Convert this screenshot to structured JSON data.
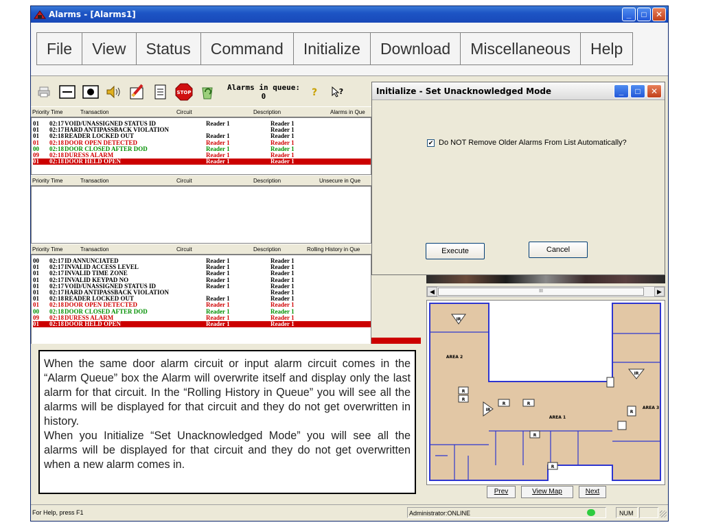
{
  "window": {
    "title": "Alarms - [Alarms1]"
  },
  "menu": [
    "File",
    "View",
    "Status",
    "Command",
    "Initialize",
    "Download",
    "Miscellaneous",
    "Help"
  ],
  "toolbar": {
    "queue_label": "Alarms in queue:",
    "queue_count": "0",
    "icons": [
      "print-icon",
      "window-icon",
      "record-icon",
      "speaker-icon",
      "acknowledge-icon",
      "notepad-icon",
      "stop-icon",
      "recycle-icon",
      "help-icon",
      "context-help-icon"
    ]
  },
  "alarm_queue": {
    "headers": [
      "Priority",
      "Time",
      "Transaction",
      "Circuit",
      "Description",
      "Alarms in Que"
    ],
    "rows": [
      {
        "p": "01",
        "t": "02:17",
        "tx": "VOID/UNASSIGNED STATUS ID",
        "c": "Reader 1",
        "d": "Reader 1",
        "style": "black"
      },
      {
        "p": "01",
        "t": "02:17",
        "tx": "HARD ANTIPASSBACK VIOLATION",
        "c": "",
        "d": "Reader 1",
        "style": "black"
      },
      {
        "p": "01",
        "t": "02:18",
        "tx": "READER LOCKED OUT",
        "c": "Reader 1",
        "d": "Reader 1",
        "style": "black"
      },
      {
        "p": "01",
        "t": "02:18",
        "tx": "DOOR OPEN DETECTED",
        "c": "Reader 1",
        "d": "Reader 1",
        "style": "red"
      },
      {
        "p": "00",
        "t": "02:18",
        "tx": "DOOR CLOSED AFTER DOD",
        "c": "Reader 1",
        "d": "Reader 1",
        "style": "green"
      },
      {
        "p": "09",
        "t": "02:18",
        "tx": "DURESS ALARM",
        "c": "Reader 1",
        "d": "Reader 1",
        "style": "red"
      },
      {
        "p": "01",
        "t": "02:18",
        "tx": "DOOR HELD OPEN",
        "c": "Reader 1",
        "d": "Reader 1",
        "style": "hl"
      }
    ]
  },
  "unsecure_queue": {
    "headers": [
      "Priority",
      "Time",
      "Transaction",
      "Circuit",
      "Description",
      "Unsecure in Que"
    ]
  },
  "history_queue": {
    "headers": [
      "Priority",
      "Time",
      "Transaction",
      "Circuit",
      "Description",
      "Rolling History in Que"
    ],
    "rows": [
      {
        "p": "00",
        "t": "02:17",
        "tx": "ID ANNUNCIATED",
        "c": "Reader 1",
        "d": "Reader 1",
        "style": "black"
      },
      {
        "p": "01",
        "t": "02:17",
        "tx": "INVALID ACCESS LEVEL",
        "c": "Reader 1",
        "d": "Reader 1",
        "style": "black"
      },
      {
        "p": "01",
        "t": "02:17",
        "tx": "INVALID TIME ZONE",
        "c": "Reader 1",
        "d": "Reader 1",
        "style": "black"
      },
      {
        "p": "01",
        "t": "02:17",
        "tx": "INVALID KEYPAD NO",
        "c": "Reader 1",
        "d": "Reader 1",
        "style": "black"
      },
      {
        "p": "01",
        "t": "02:17",
        "tx": "VOID/UNASSIGNED STATUS ID",
        "c": "Reader 1",
        "d": "Reader 1",
        "style": "black"
      },
      {
        "p": "01",
        "t": "02:17",
        "tx": "HARD ANTIPASSBACK VIOLATION",
        "c": "",
        "d": "Reader 1",
        "style": "black"
      },
      {
        "p": "01",
        "t": "02:18",
        "tx": "READER LOCKED OUT",
        "c": "Reader 1",
        "d": "Reader 1",
        "style": "black"
      },
      {
        "p": "01",
        "t": "02:18",
        "tx": "DOOR OPEN DETECTED",
        "c": "Reader 1",
        "d": "Reader 1",
        "style": "red"
      },
      {
        "p": "00",
        "t": "02:18",
        "tx": "DOOR CLOSED AFTER DOD",
        "c": "Reader 1",
        "d": "Reader 1",
        "style": "green"
      },
      {
        "p": "09",
        "t": "02:18",
        "tx": "DURESS ALARM",
        "c": "Reader 1",
        "d": "Reader 1",
        "style": "red"
      },
      {
        "p": "01",
        "t": "02:18",
        "tx": "DOOR HELD OPEN",
        "c": "Reader 1",
        "d": "Reader 1",
        "style": "hl"
      }
    ]
  },
  "dialog": {
    "title": "Initialize - Set Unacknowledged Mode",
    "checkbox_label": "Do NOT Remove Older Alarms From List Automatically?",
    "checkbox_checked": true,
    "execute_label": "Execute",
    "cancel_label": "Cancel"
  },
  "map": {
    "area_labels": [
      "AREA 2",
      "AREA 1",
      "AREA 3"
    ],
    "reader_labels": [
      "IR",
      "IR",
      "R",
      "R",
      "R",
      "R",
      "R",
      "R",
      "R",
      "IR"
    ],
    "scroll_thumb": "III",
    "prev_label": "Prev",
    "viewmap_label": "View Map",
    "next_label": "Next"
  },
  "statusbar": {
    "help": "For Help, press F1",
    "user": "Administrator:ONLINE",
    "num": "NUM"
  },
  "note": {
    "para1": "When the same door alarm circuit or input alarm circuit comes in the “Alarm Queue” box  the Alarm will overwrite itself and display only the last alarm for that circuit. In the “Rolling History in Queue” you will see all the alarms will be displayed for that circuit and they do not get overwritten in history.",
    "para2": "When you Initialize “Set Unacknowledged Mode” you will see all the alarms will be displayed for that circuit and they do not get overwritten when a new alarm comes in."
  },
  "colors": {
    "alarm_red": "#d00000",
    "alarm_green": "#009000",
    "highlight": "#cc0000",
    "map_fill": "#e2c7a5",
    "map_line": "#2d35d0"
  }
}
